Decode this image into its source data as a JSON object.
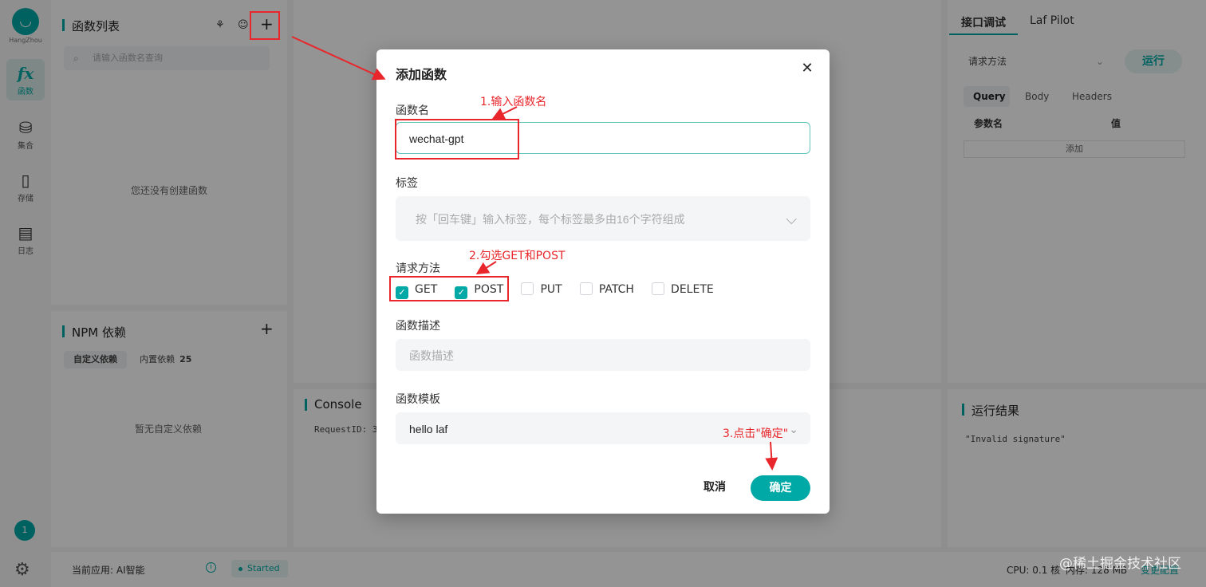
{
  "sidebar": {
    "logo_caption": "HangZhou",
    "items": [
      {
        "label": "函数",
        "icon": "fx-icon"
      },
      {
        "label": "集合",
        "icon": "database-icon"
      },
      {
        "label": "存储",
        "icon": "storage-icon"
      },
      {
        "label": "日志",
        "icon": "log-icon"
      }
    ],
    "badge": "1"
  },
  "functions_panel": {
    "title": "函数列表",
    "search_placeholder": "请输入函数名查询",
    "empty_text": "您还没有创建函数",
    "add_button": "+"
  },
  "npm_panel": {
    "title": "NPM 依赖",
    "tabs": [
      "自定义依赖",
      "内置依赖"
    ],
    "builtin_count": "25",
    "empty_text": "暂无自定义依赖",
    "add_button": "+"
  },
  "console_panel": {
    "title": "Console",
    "line": "RequestID: 3"
  },
  "right_panel": {
    "tabs": [
      "接口调试",
      "Laf Pilot"
    ],
    "method_select": "请求方法",
    "run_button": "运行",
    "subtabs": [
      "Query",
      "Body",
      "Headers"
    ],
    "col_name": "参数名",
    "col_value": "值",
    "add_row": "添加",
    "result_title": "运行结果",
    "result_text": "\"Invalid signature\""
  },
  "statusbar": {
    "app_label": "当前应用: AI智能",
    "status": "Started",
    "cpu": "CPU: 0.1 核",
    "mem": "内存: 128 MB",
    "change": "变更配置"
  },
  "watermark": "@稀土掘金技术社区",
  "modal": {
    "title": "添加函数",
    "close": "✕",
    "name_label": "函数名",
    "name_value": "wechat-gpt",
    "tags_label": "标签",
    "tags_placeholder": "按「回车键」输入标签，每个标签最多由16个字符组成",
    "method_label": "请求方法",
    "methods": [
      {
        "label": "GET",
        "checked": true
      },
      {
        "label": "POST",
        "checked": true
      },
      {
        "label": "PUT",
        "checked": false
      },
      {
        "label": "PATCH",
        "checked": false
      },
      {
        "label": "DELETE",
        "checked": false
      }
    ],
    "desc_label": "函数描述",
    "desc_placeholder": "函数描述",
    "template_label": "函数模板",
    "template_value": "hello laf",
    "cancel": "取消",
    "confirm": "确定"
  },
  "annotations": {
    "step1": "1.输入函数名",
    "step2": "2.勾选GET和POST",
    "step3": "3.点击\"确定\""
  },
  "colors": {
    "accent": "#00a9a6",
    "annotation": "#e8262b"
  }
}
